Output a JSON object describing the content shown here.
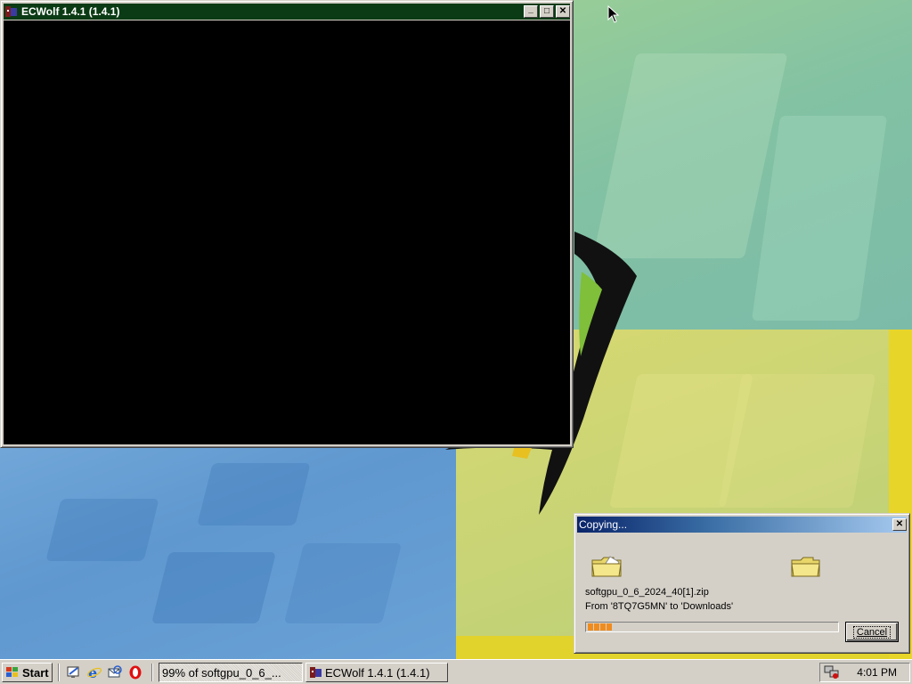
{
  "ecwolf_window": {
    "title": "ECWolf 1.4.1 (1.4.1)",
    "minimize_glyph": "_",
    "maximize_glyph": "□",
    "close_glyph": "✕"
  },
  "copying_dialog": {
    "title": "Copying...",
    "close_glyph": "✕",
    "filename": "softgpu_0_6_2024_40[1].zip",
    "from_to": "From '8TQ7G5MN' to 'Downloads'",
    "progress_fraction": 0.12,
    "progress_chunks": 4,
    "cancel_label": "Cancel"
  },
  "taskbar": {
    "start_label": "Start",
    "quick_launch": [
      "show-desktop-icon",
      "internet-explorer-icon",
      "outlook-express-icon",
      "opera-icon"
    ],
    "tasks": [
      {
        "label": "99% of softgpu_0_6_...",
        "pressed": true
      },
      {
        "label": "ECWolf 1.4.1 (1.4.1)",
        "pressed": false
      }
    ],
    "clock": "4:01 PM"
  },
  "colors": {
    "ecwolf_titlebar": "#0b3b14",
    "dialog_titlebar": "#0a246a",
    "progress_fill": "#f08c1e",
    "window_face": "#d4d0c8"
  }
}
